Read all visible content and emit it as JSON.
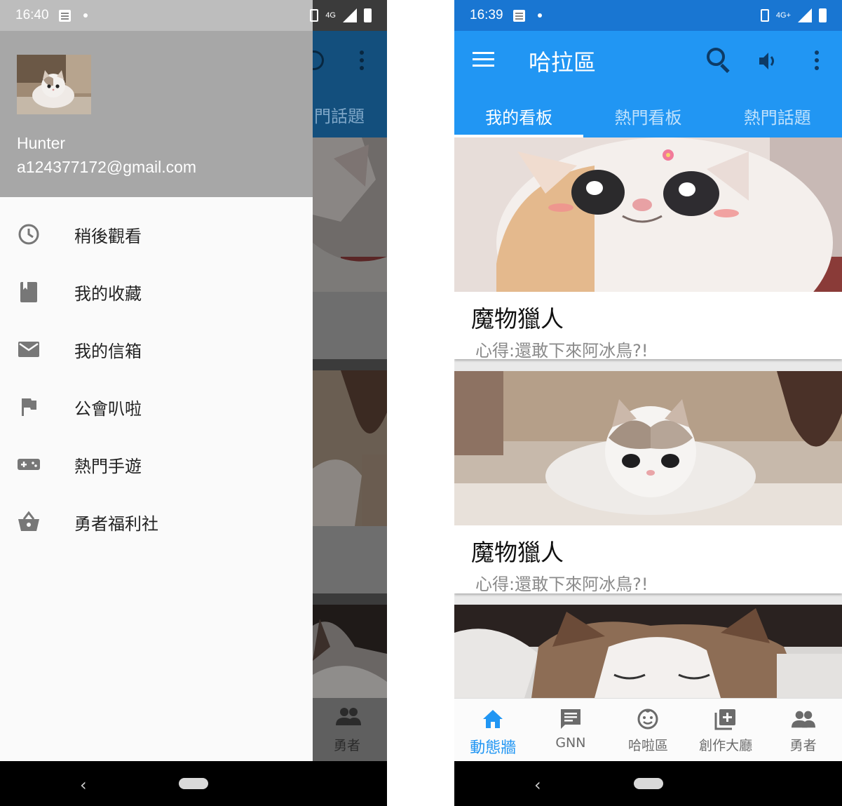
{
  "left_screen": {
    "status": {
      "time": "16:40",
      "network": "4G"
    },
    "drawer": {
      "user_name": "Hunter",
      "user_email": "a124377172@gmail.com",
      "items": [
        {
          "label": "稍後觀看",
          "icon": "clock-icon"
        },
        {
          "label": "我的收藏",
          "icon": "bookmark-icon"
        },
        {
          "label": "我的信箱",
          "icon": "mail-icon"
        },
        {
          "label": "公會叭啦",
          "icon": "flag-icon"
        },
        {
          "label": "熱門手遊",
          "icon": "gamepad-icon"
        },
        {
          "label": "勇者福利社",
          "icon": "basket-icon"
        }
      ]
    },
    "background": {
      "tab_fragment": "門話題",
      "nav_label": "勇者"
    }
  },
  "right_screen": {
    "status": {
      "time": "16:39",
      "network": "4G+"
    },
    "appbar": {
      "title": "哈拉區"
    },
    "tabs": [
      {
        "label": "我的看板",
        "active": true
      },
      {
        "label": "熱門看板",
        "active": false
      },
      {
        "label": "熱門話題",
        "active": false
      }
    ],
    "cards": [
      {
        "title": "魔物獵人",
        "subtitle": "心得:還敢下來阿冰鳥?!"
      },
      {
        "title": "魔物獵人",
        "subtitle": "心得:還敢下來阿冰鳥?!"
      },
      {
        "title": "",
        "subtitle": ""
      }
    ],
    "bottom_nav": [
      {
        "label": "動態牆",
        "icon": "home-icon",
        "active": true
      },
      {
        "label": "GNN",
        "icon": "news-icon",
        "active": false
      },
      {
        "label": "哈啦區",
        "icon": "baby-face-icon",
        "active": false
      },
      {
        "label": "創作大廳",
        "icon": "add-library-icon",
        "active": false
      },
      {
        "label": "勇者",
        "icon": "people-icon",
        "active": false
      }
    ]
  },
  "colors": {
    "primary": "#2196f3",
    "text_secondary": "#8a8a8a",
    "drawer_header": "#a7a7a7"
  }
}
